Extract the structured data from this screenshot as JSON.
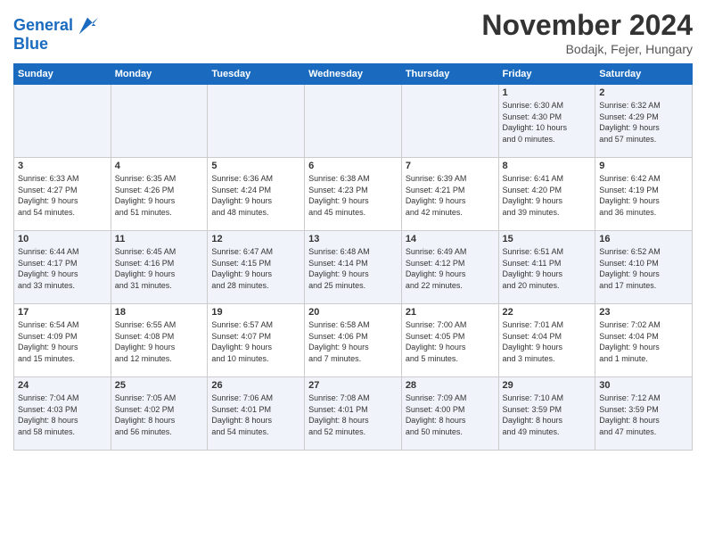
{
  "header": {
    "logo_line1": "General",
    "logo_line2": "Blue",
    "month_title": "November 2024",
    "location": "Bodajk, Fejer, Hungary"
  },
  "days_of_week": [
    "Sunday",
    "Monday",
    "Tuesday",
    "Wednesday",
    "Thursday",
    "Friday",
    "Saturday"
  ],
  "weeks": [
    [
      {
        "day": "",
        "info": ""
      },
      {
        "day": "",
        "info": ""
      },
      {
        "day": "",
        "info": ""
      },
      {
        "day": "",
        "info": ""
      },
      {
        "day": "",
        "info": ""
      },
      {
        "day": "1",
        "info": "Sunrise: 6:30 AM\nSunset: 4:30 PM\nDaylight: 10 hours\nand 0 minutes."
      },
      {
        "day": "2",
        "info": "Sunrise: 6:32 AM\nSunset: 4:29 PM\nDaylight: 9 hours\nand 57 minutes."
      }
    ],
    [
      {
        "day": "3",
        "info": "Sunrise: 6:33 AM\nSunset: 4:27 PM\nDaylight: 9 hours\nand 54 minutes."
      },
      {
        "day": "4",
        "info": "Sunrise: 6:35 AM\nSunset: 4:26 PM\nDaylight: 9 hours\nand 51 minutes."
      },
      {
        "day": "5",
        "info": "Sunrise: 6:36 AM\nSunset: 4:24 PM\nDaylight: 9 hours\nand 48 minutes."
      },
      {
        "day": "6",
        "info": "Sunrise: 6:38 AM\nSunset: 4:23 PM\nDaylight: 9 hours\nand 45 minutes."
      },
      {
        "day": "7",
        "info": "Sunrise: 6:39 AM\nSunset: 4:21 PM\nDaylight: 9 hours\nand 42 minutes."
      },
      {
        "day": "8",
        "info": "Sunrise: 6:41 AM\nSunset: 4:20 PM\nDaylight: 9 hours\nand 39 minutes."
      },
      {
        "day": "9",
        "info": "Sunrise: 6:42 AM\nSunset: 4:19 PM\nDaylight: 9 hours\nand 36 minutes."
      }
    ],
    [
      {
        "day": "10",
        "info": "Sunrise: 6:44 AM\nSunset: 4:17 PM\nDaylight: 9 hours\nand 33 minutes."
      },
      {
        "day": "11",
        "info": "Sunrise: 6:45 AM\nSunset: 4:16 PM\nDaylight: 9 hours\nand 31 minutes."
      },
      {
        "day": "12",
        "info": "Sunrise: 6:47 AM\nSunset: 4:15 PM\nDaylight: 9 hours\nand 28 minutes."
      },
      {
        "day": "13",
        "info": "Sunrise: 6:48 AM\nSunset: 4:14 PM\nDaylight: 9 hours\nand 25 minutes."
      },
      {
        "day": "14",
        "info": "Sunrise: 6:49 AM\nSunset: 4:12 PM\nDaylight: 9 hours\nand 22 minutes."
      },
      {
        "day": "15",
        "info": "Sunrise: 6:51 AM\nSunset: 4:11 PM\nDaylight: 9 hours\nand 20 minutes."
      },
      {
        "day": "16",
        "info": "Sunrise: 6:52 AM\nSunset: 4:10 PM\nDaylight: 9 hours\nand 17 minutes."
      }
    ],
    [
      {
        "day": "17",
        "info": "Sunrise: 6:54 AM\nSunset: 4:09 PM\nDaylight: 9 hours\nand 15 minutes."
      },
      {
        "day": "18",
        "info": "Sunrise: 6:55 AM\nSunset: 4:08 PM\nDaylight: 9 hours\nand 12 minutes."
      },
      {
        "day": "19",
        "info": "Sunrise: 6:57 AM\nSunset: 4:07 PM\nDaylight: 9 hours\nand 10 minutes."
      },
      {
        "day": "20",
        "info": "Sunrise: 6:58 AM\nSunset: 4:06 PM\nDaylight: 9 hours\nand 7 minutes."
      },
      {
        "day": "21",
        "info": "Sunrise: 7:00 AM\nSunset: 4:05 PM\nDaylight: 9 hours\nand 5 minutes."
      },
      {
        "day": "22",
        "info": "Sunrise: 7:01 AM\nSunset: 4:04 PM\nDaylight: 9 hours\nand 3 minutes."
      },
      {
        "day": "23",
        "info": "Sunrise: 7:02 AM\nSunset: 4:04 PM\nDaylight: 9 hours\nand 1 minute."
      }
    ],
    [
      {
        "day": "24",
        "info": "Sunrise: 7:04 AM\nSunset: 4:03 PM\nDaylight: 8 hours\nand 58 minutes."
      },
      {
        "day": "25",
        "info": "Sunrise: 7:05 AM\nSunset: 4:02 PM\nDaylight: 8 hours\nand 56 minutes."
      },
      {
        "day": "26",
        "info": "Sunrise: 7:06 AM\nSunset: 4:01 PM\nDaylight: 8 hours\nand 54 minutes."
      },
      {
        "day": "27",
        "info": "Sunrise: 7:08 AM\nSunset: 4:01 PM\nDaylight: 8 hours\nand 52 minutes."
      },
      {
        "day": "28",
        "info": "Sunrise: 7:09 AM\nSunset: 4:00 PM\nDaylight: 8 hours\nand 50 minutes."
      },
      {
        "day": "29",
        "info": "Sunrise: 7:10 AM\nSunset: 3:59 PM\nDaylight: 8 hours\nand 49 minutes."
      },
      {
        "day": "30",
        "info": "Sunrise: 7:12 AM\nSunset: 3:59 PM\nDaylight: 8 hours\nand 47 minutes."
      }
    ]
  ]
}
